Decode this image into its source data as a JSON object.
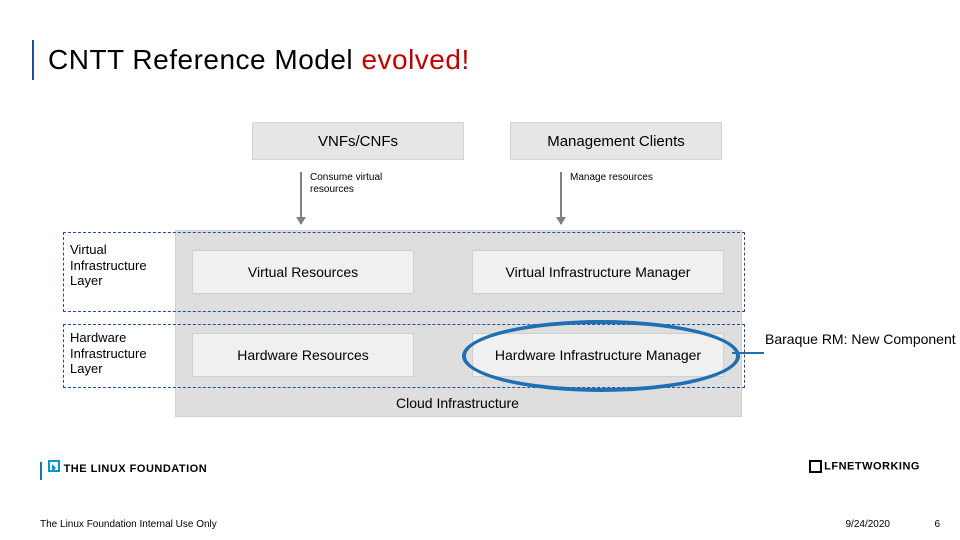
{
  "title_part1": "CNTT Reference Model ",
  "title_part2": "evolved!",
  "top": {
    "vnfs": "VNFs/CNFs",
    "mgmt": "Management Clients"
  },
  "arrows": {
    "consume": "Consume virtual\nresources",
    "manage": "Manage resources"
  },
  "layers": {
    "virtual": "Virtual Infrastructure Layer",
    "hardware": "Hardware Infrastructure Layer"
  },
  "boxes": {
    "virtual_resources": "Virtual Resources",
    "hardware_resources": "Hardware Resources",
    "vim": "Virtual Infrastructure Manager",
    "him": "Hardware Infrastructure Manager"
  },
  "cloud_label": "Cloud Infrastructure",
  "callout": "Baraque RM: New Component",
  "footer": {
    "logo1": "THE LINUX FOUNDATION",
    "logo2": "LFNETWORKING",
    "disclaimer": "The Linux Foundation Internal Use Only",
    "date": "9/24/2020",
    "page": "6"
  }
}
